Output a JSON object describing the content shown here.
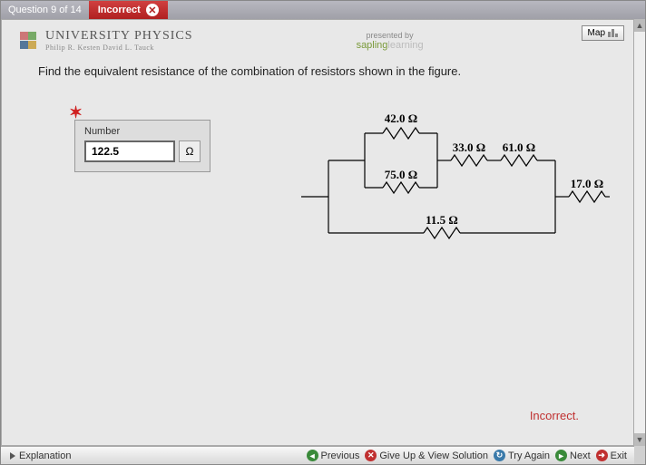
{
  "topbar": {
    "question_count": "Question 9 of 14",
    "status": "Incorrect"
  },
  "map_button": "Map",
  "header": {
    "title": "UNIVERSITY PHYSICS",
    "authors": "Philip R. Kesten    David L. Tauck",
    "presented": "presented by",
    "brand1": "sapling",
    "brand2": "learning"
  },
  "question": "Find the equivalent resistance of the combination of resistors shown in the figure.",
  "answer": {
    "label": "Number",
    "value": "122.5",
    "unit": "Ω"
  },
  "resistors": {
    "r1": "42.0  Ω",
    "r2": "33.0  Ω",
    "r3": "61.0  Ω",
    "r4": "75.0  Ω",
    "r5": "11.5  Ω",
    "r6": "17.0  Ω"
  },
  "feedback": "Incorrect.",
  "explanation": "Explanation",
  "nav": {
    "previous": "Previous",
    "giveup": "Give Up & View Solution",
    "tryagain": "Try Again",
    "next": "Next",
    "exit": "Exit"
  }
}
